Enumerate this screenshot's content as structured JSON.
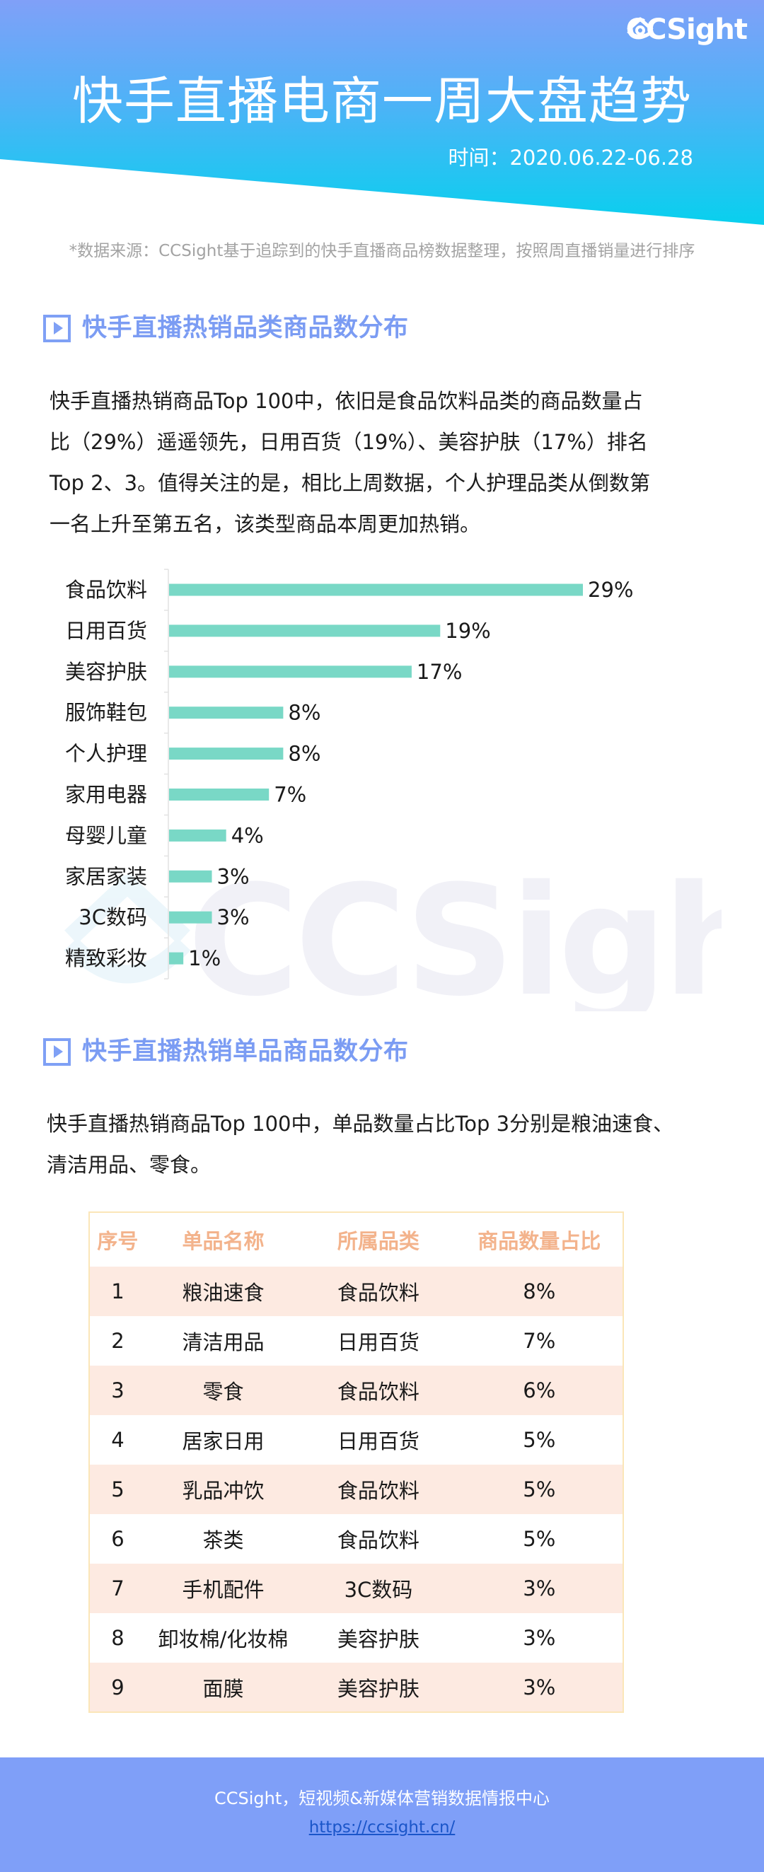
{
  "header": {
    "brand": "CCSight",
    "title": "快手直播电商一周大盘趋势",
    "date_label": "时间：2020.06.22-06.28",
    "gradient_top": "#7fa0f7",
    "gradient_bottom": "#0ad0ef"
  },
  "source_note": "*数据来源：CCSight基于追踪到的快手直播商品榜数据整理，按照周直播销量进行排序",
  "section1": {
    "title": "快手直播热销品类商品数分布",
    "paragraph_lines": [
      "快手直播热销商品Top 100中，依旧是食品饮料品类的商品数量占",
      "比（29%）遥遥领先，日用百货（19%）、美容护肤（17%）排名",
      "Top 2、3。值得关注的是，相比上周数据，个人护理品类从倒数第",
      "一名上升至第五名，该类型商品本周更加热销。"
    ]
  },
  "chart_data": {
    "type": "bar",
    "orientation": "horizontal",
    "title": "",
    "xlabel": "",
    "ylabel": "",
    "categories": [
      "食品饮料",
      "日用百货",
      "美容护肤",
      "服饰鞋包",
      "个人护理",
      "家用电器",
      "母婴儿童",
      "家居家装",
      "3C数码",
      "精致彩妆"
    ],
    "values": [
      29,
      19,
      17,
      8,
      8,
      7,
      4,
      3,
      3,
      1
    ],
    "value_labels": [
      "29%",
      "19%",
      "17%",
      "8%",
      "8%",
      "7%",
      "4%",
      "3%",
      "3%",
      "1%"
    ],
    "unit": "%",
    "xlim": [
      0,
      29
    ],
    "grid": false,
    "legend": "none",
    "bar_color": "#79d8c6",
    "watermark": "CCSight"
  },
  "section2": {
    "title": "快手直播热销单品商品数分布",
    "paragraph_lines": [
      "快手直播热销商品Top 100中，单品数量占比Top 3分别是粮油速食、",
      "清洁用品、零食。"
    ]
  },
  "table": {
    "columns": [
      "序号",
      "单品名称",
      "所属品类",
      "商品数量占比"
    ],
    "rows": [
      [
        "1",
        "粮油速食",
        "食品饮料",
        "8%"
      ],
      [
        "2",
        "清洁用品",
        "日用百货",
        "7%"
      ],
      [
        "3",
        "零食",
        "食品饮料",
        "6%"
      ],
      [
        "4",
        "居家日用",
        "日用百货",
        "5%"
      ],
      [
        "5",
        "乳品冲饮",
        "食品饮料",
        "5%"
      ],
      [
        "6",
        "茶类",
        "食品饮料",
        "5%"
      ],
      [
        "7",
        "手机配件",
        "3C数码",
        "3%"
      ],
      [
        "8",
        "卸妆棉/化妆棉",
        "美容护肤",
        "3%"
      ],
      [
        "9",
        "面膜",
        "美容护肤",
        "3%"
      ]
    ],
    "header_color": "#f3b38c",
    "stripe_color": "#fdeae1"
  },
  "footer": {
    "text": "CCSight，短视频&新媒体营销数据情报中心",
    "link": "https://ccsight.cn/",
    "background": "#7f9ff8"
  }
}
